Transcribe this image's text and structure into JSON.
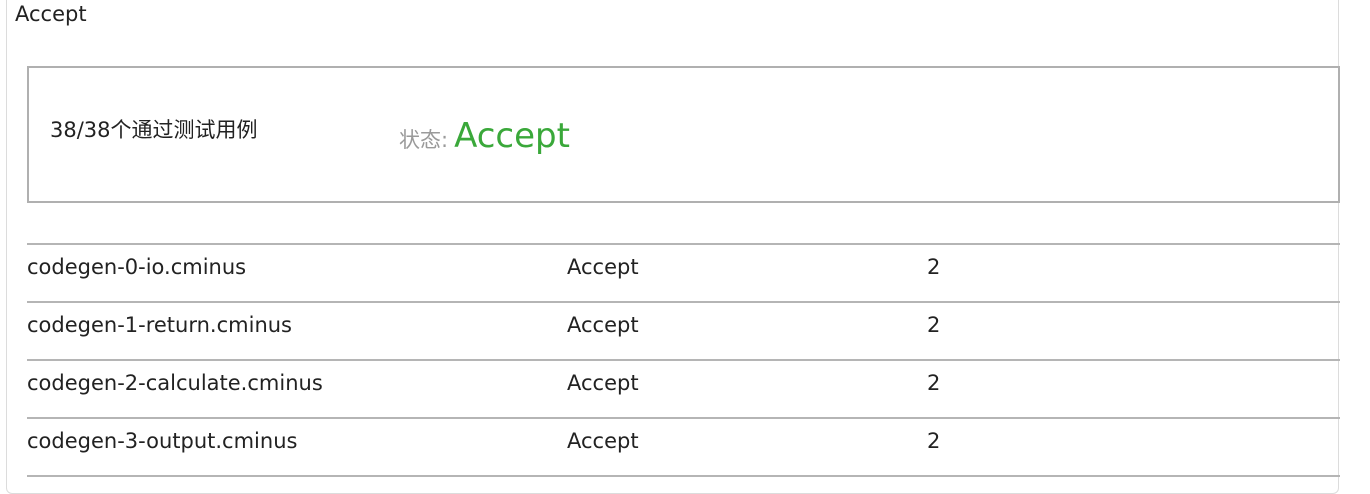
{
  "panel": {
    "title": "Accept"
  },
  "summary": {
    "count_text": "38/38个通过测试用例",
    "status_label": "状态:",
    "status_value": "Accept",
    "status_color": "#3aa83a"
  },
  "results": {
    "rows": [
      {
        "name": "codegen-0-io.cminus",
        "status": "Accept",
        "score": "2"
      },
      {
        "name": "codegen-1-return.cminus",
        "status": "Accept",
        "score": "2"
      },
      {
        "name": "codegen-2-calculate.cminus",
        "status": "Accept",
        "score": "2"
      },
      {
        "name": "codegen-3-output.cminus",
        "status": "Accept",
        "score": "2"
      }
    ]
  }
}
